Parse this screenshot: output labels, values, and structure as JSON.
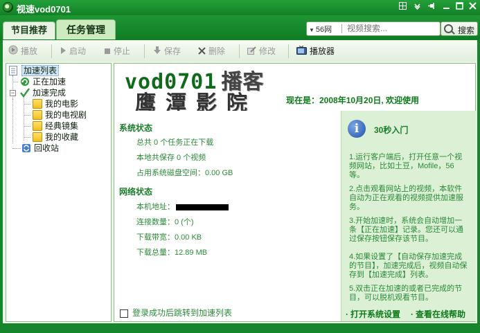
{
  "window": {
    "title": "视速vod0701",
    "controls": [
      "window-grid-icon",
      "dropdown-icon",
      "pin-icon",
      "minimize-icon",
      "maximize-icon",
      "close-icon"
    ]
  },
  "tabs": [
    {
      "label": "节目推荐",
      "active": false
    },
    {
      "label": "任务管理",
      "active": true
    }
  ],
  "search": {
    "source": "56网",
    "placeholder": "视频搜索...",
    "button_label": "搜索"
  },
  "toolbar": {
    "play": "播放",
    "start": "启动",
    "stop": "停止",
    "save": "保存",
    "delete": "删除",
    "modify": "修改",
    "player": "播放器"
  },
  "tree": {
    "root": "加速列表",
    "accelerating": "正在加速",
    "completed": "加速完成",
    "children": [
      "我的电影",
      "我的电视剧",
      "经典镜集",
      "我的收藏"
    ],
    "recycle": "回收站"
  },
  "banner": {
    "logo_en": "vod0701",
    "logo_cn": "播客",
    "cinema": "鹰潭影院",
    "date_text": "现在是：2008年10月20日, 欢迎使用"
  },
  "system_status": {
    "title": "系统状态",
    "downloading": "总共 0 个任务正在下载",
    "saved": "本地共保存 0 个视频",
    "disk": "占用系统磁盘空间：0.00 GB"
  },
  "network_status": {
    "title": "网络状态",
    "ip_label": "本机地址：",
    "connections": "连接数量：0 (个)",
    "bandwidth": "下载带宽：0.00 KB",
    "total": "下载总量：12.89 MB"
  },
  "checkbox": {
    "label": "登录成功后跳转到加速列表",
    "checked": false
  },
  "intro": {
    "title": "30秒入门",
    "steps": [
      "1.运行客户端后，打开任意一个视频网站，比如土豆，Mofile，56 等。",
      "2.点击观看网站上的视频，本软件自动为正在观看的视频提供加速服务。",
      "3.开始加速时，系统会自动增加一条【正在加速】记录。您还可以通过保存按钮保存该节目。",
      "4.如果设置了【自动保存加速完成的节目】，加速完成后，视频自动保存到【加速完成】列表。",
      "5.双击正在加速的或者已完成的节目，可以脱机观看节目。"
    ],
    "link_settings": "打开系统设置",
    "link_help": "查看在线帮助"
  },
  "colors": {
    "frame_green": "#17852b",
    "accent_text": "#2a8a37",
    "panel_light": "#dcf0d6"
  }
}
